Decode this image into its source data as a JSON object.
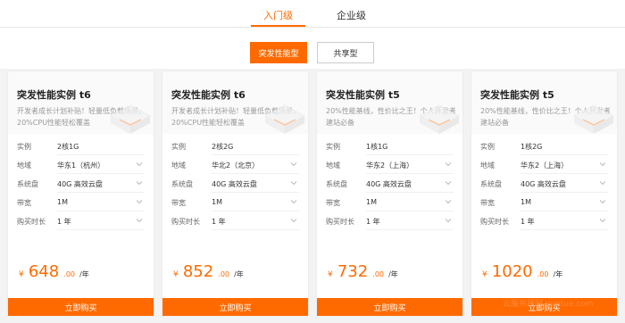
{
  "tabs": [
    {
      "label": "入门级",
      "active": true
    },
    {
      "label": "企业级",
      "active": false
    }
  ],
  "segments": [
    {
      "label": "突发性能型",
      "active": true
    },
    {
      "label": "共享型",
      "active": false
    }
  ],
  "spec_labels": {
    "instance": "实例",
    "region": "地域",
    "disk": "系统盘",
    "bandwidth": "带宽",
    "duration": "购买时长"
  },
  "cards": [
    {
      "title": "突发性能实例 t6",
      "desc": "开发者成长计划补贴！轻量低负载场景，20%CPU性能轻松覆盖",
      "instance": "2核1G",
      "region": "华东1（杭州）",
      "disk": "40G 高效云盘",
      "bandwidth": "1M",
      "duration": "1 年",
      "price_symbol": "¥",
      "price": "648",
      "price_decimal": ".00",
      "price_unit": "/年",
      "buy": "立即购买"
    },
    {
      "title": "突发性能实例 t6",
      "desc": "开发者成长计划补贴！轻量低负载场景，20%CPU性能轻松覆盖",
      "instance": "2核2G",
      "region": "华北2（北京）",
      "disk": "40G 高效云盘",
      "bandwidth": "1M",
      "duration": "1 年",
      "price_symbol": "¥",
      "price": "852",
      "price_decimal": ".00",
      "price_unit": "/年",
      "buy": "立即购买"
    },
    {
      "title": "突发性能实例 t5",
      "desc": "20%性能基线，性价比之王！个人开发者建站必备",
      "instance": "1核1G",
      "region": "华东2（上海）",
      "disk": "40G 高效云盘",
      "bandwidth": "1M",
      "duration": "1 年",
      "price_symbol": "¥",
      "price": "732",
      "price_decimal": ".00",
      "price_unit": "/年",
      "buy": "立即购买"
    },
    {
      "title": "突发性能实例 t5",
      "desc": "20%性能基线，性价比之王！个人开发者建站必备",
      "instance": "1核2G",
      "region": "华东2（上海）",
      "disk": "40G 高效云盘",
      "bandwidth": "1M",
      "duration": "1 年",
      "price_symbol": "¥",
      "price": "1020",
      "price_decimal": ".00",
      "price_unit": "/年",
      "buy": "立即购买"
    }
  ],
  "watermark": "云服务器网 yuntue.com",
  "colors": {
    "accent": "#ff6a00"
  }
}
